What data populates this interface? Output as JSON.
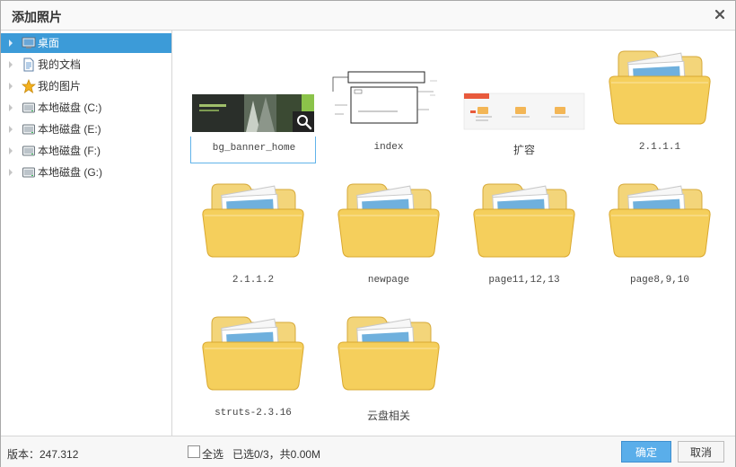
{
  "dialog": {
    "title": "添加照片"
  },
  "sidebar": {
    "items": [
      {
        "label": "桌面",
        "icon": "desktop-icon",
        "selected": true
      },
      {
        "label": "我的文档",
        "icon": "document-icon",
        "selected": false
      },
      {
        "label": "我的图片",
        "icon": "star-folder-icon",
        "selected": false
      },
      {
        "label": "本地磁盘  (C:)",
        "icon": "disk-icon",
        "selected": false
      },
      {
        "label": "本地磁盘  (E:)",
        "icon": "disk-icon",
        "selected": false
      },
      {
        "label": "本地磁盘  (F:)",
        "icon": "disk-icon",
        "selected": false
      },
      {
        "label": "本地磁盘  (G:)",
        "icon": "disk-icon",
        "selected": false
      }
    ]
  },
  "files": [
    {
      "name": "bg_banner_home",
      "type": "image",
      "selected": true
    },
    {
      "name": "index",
      "type": "image",
      "selected": false
    },
    {
      "name": "扩容",
      "type": "image",
      "selected": false
    },
    {
      "name": "2.1.1.1",
      "type": "folder",
      "selected": false
    },
    {
      "name": "2.1.1.2",
      "type": "folder",
      "selected": false
    },
    {
      "name": "newpage",
      "type": "folder",
      "selected": false
    },
    {
      "name": "page11,12,13",
      "type": "folder",
      "selected": false
    },
    {
      "name": "page8,9,10",
      "type": "folder",
      "selected": false
    },
    {
      "name": "struts-2.3.16",
      "type": "folder",
      "selected": false
    },
    {
      "name": "云盘相关",
      "type": "folder",
      "selected": false
    }
  ],
  "footer": {
    "version": "版本：247.312",
    "select_all_label": "全选",
    "selected_info": "已选0/3，共0.00M",
    "ok_label": "确定",
    "cancel_label": "取消"
  },
  "colors": {
    "accent": "#3c9bd8",
    "ok_button": "#5aaeea",
    "folder": "#f5cf5c"
  }
}
